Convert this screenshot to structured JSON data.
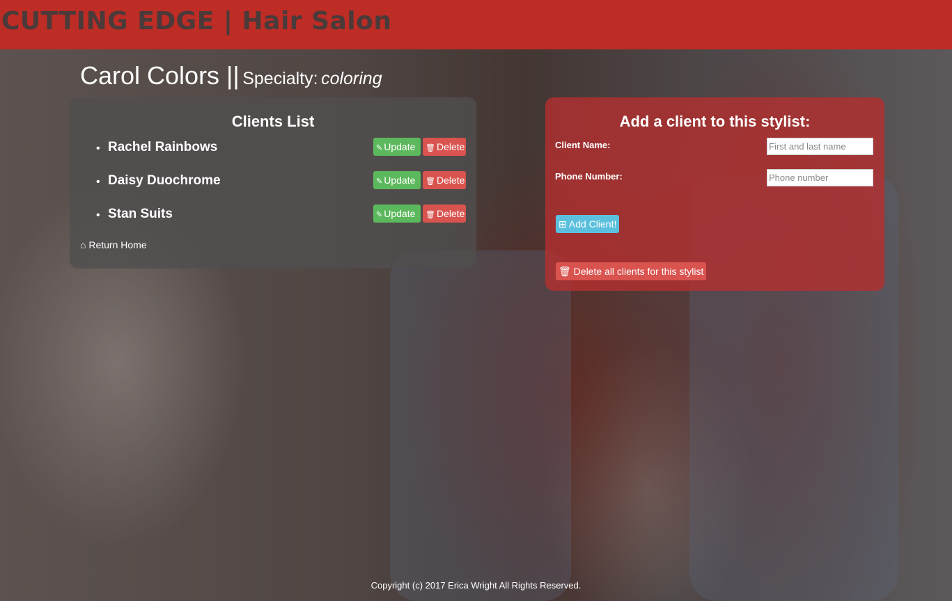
{
  "header": {
    "brand": "CUTTING EDGE | Hair Salon"
  },
  "stylist": {
    "name": "Carol Colors ||",
    "specialty_label": "Specialty:",
    "specialty_value": "coloring"
  },
  "clients_panel": {
    "title": "Clients List",
    "clients": [
      {
        "name": "Rachel Rainbows",
        "update_label": "Update",
        "delete_label": "Delete"
      },
      {
        "name": "Daisy Duochrome",
        "update_label": "Update",
        "delete_label": "Delete"
      },
      {
        "name": "Stan Suits",
        "update_label": "Update",
        "delete_label": "Delete"
      }
    ],
    "return_home_label": "Return Home"
  },
  "add_panel": {
    "title": "Add a client to this stylist:",
    "client_name_label": "Client Name:",
    "client_name_placeholder": "First and last name",
    "phone_label": "Phone Number:",
    "phone_placeholder": "Phone number",
    "add_button_label": "Add Client!",
    "delete_all_label": "Delete all clients for this stylist"
  },
  "footer": {
    "copyright": "Copyright (c) 2017 Erica Wright All Rights Reserved."
  },
  "icons": {
    "update": "pencil-square-icon",
    "delete": "trash-icon",
    "home": "home-icon",
    "add": "plus-square-icon"
  },
  "colors": {
    "header_bg": "#bd2c25",
    "brand_text": "#4a3a3a",
    "update_btn": "#5cb85c",
    "delete_btn": "#d9534f",
    "add_btn": "#5bc0de"
  }
}
